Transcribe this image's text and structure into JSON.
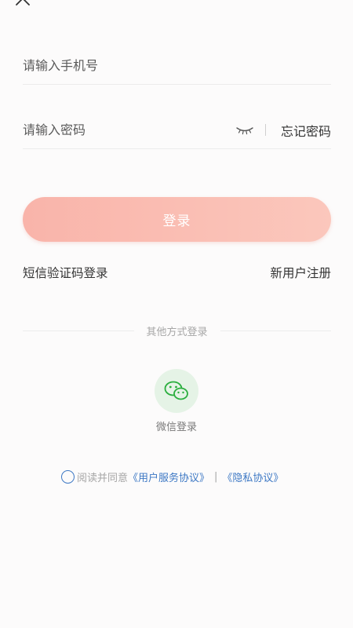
{
  "icons": {
    "close": "close-icon",
    "eye": "eye-closed-icon",
    "wechat": "wechat-icon",
    "radio": "radio-unchecked-icon"
  },
  "colors": {
    "accent_button": "#fbbcb1",
    "link_blue": "#3d78c4",
    "wechat_green": "#2aae3e",
    "wechat_bg": "#e5f3e6"
  },
  "form": {
    "phone_placeholder": "请输入手机号",
    "password_placeholder": "请输入密码",
    "forgot_password": "忘记密码"
  },
  "actions": {
    "login": "登录",
    "sms_login": "短信验证码登录",
    "register": "新用户注册"
  },
  "other_login": {
    "divider_text": "其他方式登录",
    "wechat_label": "微信登录"
  },
  "agreement": {
    "prefix": "阅读并同意",
    "user_agreement": "《用户服务协议》",
    "separator": "|",
    "privacy_policy": "《隐私协议》"
  }
}
